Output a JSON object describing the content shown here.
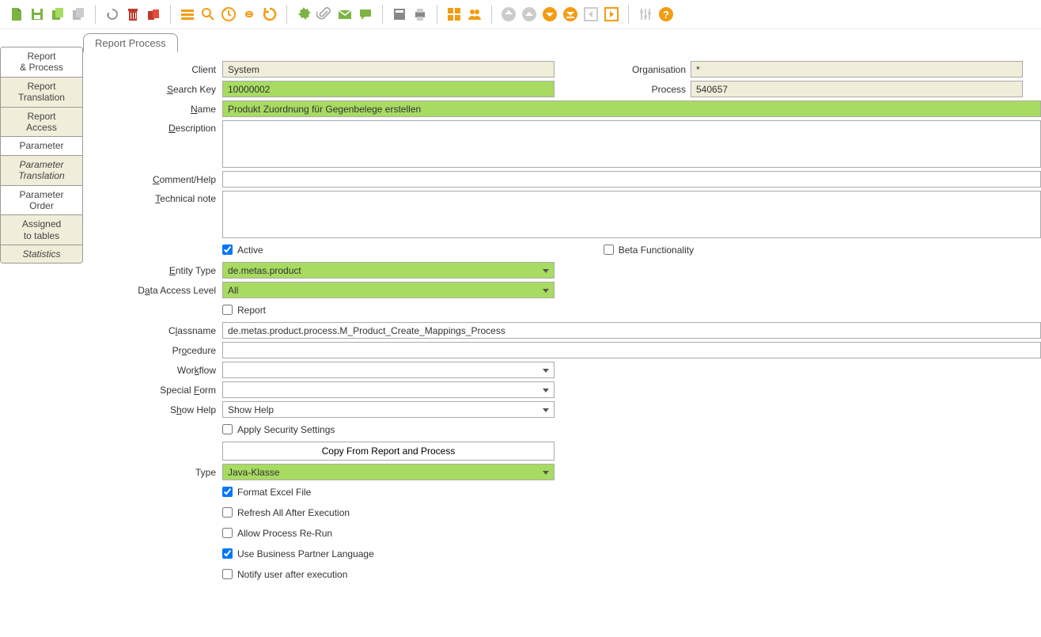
{
  "toolbar_icons": [
    "new",
    "save",
    "copy",
    "copy-disabled",
    "sep",
    "undo",
    "delete",
    "delete-all",
    "sep",
    "grid",
    "search",
    "history",
    "link",
    "refresh",
    "sep",
    "gear",
    "attachment",
    "mail",
    "chat",
    "sep",
    "archive",
    "print",
    "sep",
    "apps",
    "users",
    "sep",
    "first",
    "up",
    "down",
    "last",
    "prev",
    "next",
    "sep",
    "preferences",
    "help"
  ],
  "tab": {
    "label": "Report  Process"
  },
  "sidebar": {
    "items": [
      {
        "label_line1": "Report",
        "label_line2": "& Process",
        "active": false,
        "italic": false
      },
      {
        "label_line1": "Report",
        "label_line2": "Translation",
        "active": true,
        "italic": false
      },
      {
        "label_line1": "Report",
        "label_line2": "Access",
        "active": true,
        "italic": false
      },
      {
        "label_line1": "Parameter",
        "label_line2": "",
        "active": false,
        "italic": false
      },
      {
        "label_line1": "Parameter",
        "label_line2": "Translation",
        "active": true,
        "italic": true
      },
      {
        "label_line1": "Parameter",
        "label_line2": "Order",
        "active": false,
        "italic": false
      },
      {
        "label_line1": "Assigned",
        "label_line2": "to tables",
        "active": true,
        "italic": false
      },
      {
        "label_line1": "Statistics",
        "label_line2": "",
        "active": true,
        "italic": true
      }
    ]
  },
  "form": {
    "client_label": "Client",
    "client_value": "System",
    "organisation_label": "Organisation",
    "organisation_value": "*",
    "search_key_label": "Search Key",
    "search_key_value": "10000002",
    "process_label": "Process",
    "process_value": "540657",
    "name_label": "Name",
    "name_value": "Produkt Zuordnung für Gegenbelege erstellen",
    "description_label": "Description",
    "description_value": "",
    "comment_label": "Comment/Help",
    "comment_value": "",
    "technical_note_label": "Technical note",
    "technical_note_value": "",
    "active_label": "Active",
    "active_checked": true,
    "beta_label": "Beta Functionality",
    "beta_checked": false,
    "entity_type_label": "Entity Type",
    "entity_type_value": "de.metas.product",
    "data_access_label": "Data Access Level",
    "data_access_value": "All",
    "report_label": "Report",
    "report_checked": false,
    "classname_label": "Classname",
    "classname_value": "de.metas.product.process.M_Product_Create_Mappings_Process",
    "procedure_label": "Procedure",
    "procedure_value": "",
    "workflow_label": "Workflow",
    "workflow_value": "",
    "special_form_label": "Special Form",
    "special_form_value": "",
    "show_help_label": "Show Help",
    "show_help_value": "Show Help",
    "apply_security_label": "Apply Security Settings",
    "apply_security_checked": false,
    "copy_from_button": "Copy From Report and Process",
    "type_label": "Type",
    "type_value": "Java-Klasse",
    "format_excel_label": "Format Excel File",
    "format_excel_checked": true,
    "refresh_all_label": "Refresh All After Execution",
    "refresh_all_checked": false,
    "allow_rerun_label": "Allow Process Re-Run",
    "allow_rerun_checked": false,
    "use_bp_lang_label": "Use Business Partner Language",
    "use_bp_lang_checked": true,
    "notify_user_label": "Notify user after execution",
    "notify_user_checked": false
  },
  "colors": {
    "green_light": "#a8db61",
    "beige": "#f0edd9",
    "orange": "#f39c12",
    "green": "#7cb342",
    "red": "#c0392b",
    "grey": "#aaaaaa"
  }
}
